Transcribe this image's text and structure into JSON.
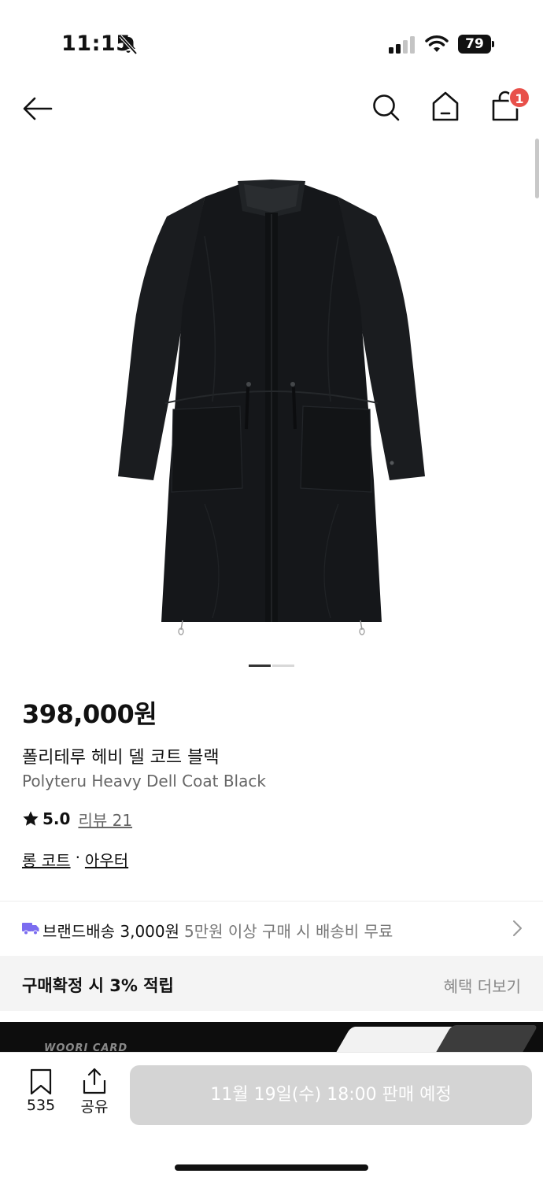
{
  "status_bar": {
    "time": "11:15",
    "battery": "79"
  },
  "nav": {
    "cart_count": "1"
  },
  "product": {
    "price": "398,000원",
    "name_ko": "폴리테루 헤비 델 코트 블랙",
    "name_en": "Polyteru Heavy Dell Coat Black",
    "rating": "5.0",
    "review_label": "리뷰 21",
    "categories": [
      "롱 코트",
      "아우터"
    ],
    "category_separator": "·",
    "image_count": 2,
    "image_index": 1
  },
  "shipping": {
    "label": "브랜드배송 3,000원",
    "note": "5만원 이상 구매 시 배송비 무료"
  },
  "benefit": {
    "title": "구매확정 시 3% 적립",
    "more_label": "혜택 더보기"
  },
  "banner": {
    "brand": "WOORI CARD"
  },
  "bottom_bar": {
    "bookmark_count": "535",
    "share_label": "공유",
    "buy_label": "11월 19일(수) 18:00 판매 예정"
  },
  "colors": {
    "badge": "#e8504a",
    "truck": "#7b6cf0",
    "disabled_button": "#d4d4d4"
  },
  "icons": [
    "bell-slash-icon",
    "signal-icon",
    "wifi-icon",
    "back-arrow-icon",
    "search-icon",
    "home-icon",
    "shopping-bag-icon",
    "star-icon",
    "truck-icon",
    "chevron-right-icon",
    "bookmark-icon",
    "share-icon"
  ]
}
